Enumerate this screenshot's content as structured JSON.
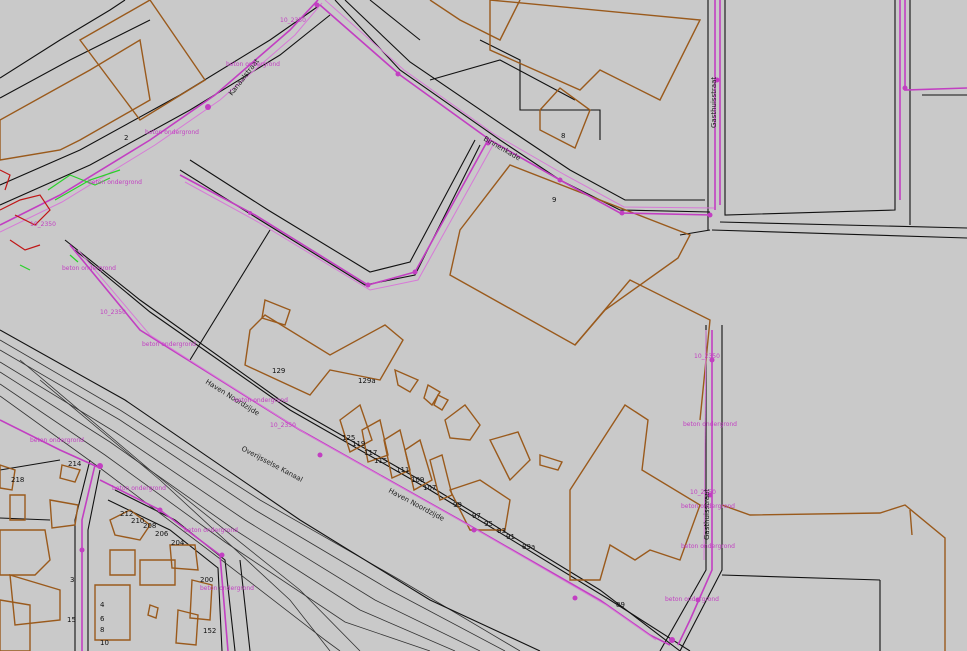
{
  "map": {
    "colors": {
      "background": "#c9c9c9",
      "parcel_lines": "#111111",
      "buildings": "#9a5a1c",
      "cables": "#c23fc2",
      "markings_green": "#2ad12a",
      "markings_red": "#c01616"
    },
    "streets": {
      "kanaalstraat": "Kanaalstraat",
      "overijsselse_kanaal": "Overijsselse Kanaal",
      "haven_noordzijde_1": "Haven Noordzijde",
      "haven_noordzijde_2": "Haven Noordzijde",
      "binnenkade": "Binnenkade",
      "gasthuisstraat_1": "Gasthuisstraat",
      "gasthuisstraat_2": "Gasthuisstraat"
    },
    "house_numbers": {
      "n2": "2",
      "n8": "8",
      "n9": "9",
      "n129": "129",
      "n129a": "129a",
      "n125": "125",
      "n119": "119",
      "n117": "117",
      "n115": "115",
      "n111": "111",
      "n109": "109",
      "n107": "107",
      "n99": "99",
      "n97": "97",
      "n95": "95",
      "n93": "93",
      "n91": "91",
      "n89a": "89a",
      "n89": "89",
      "n214": "214",
      "n218": "218",
      "n212": "212",
      "n210": "210",
      "n208": "208",
      "n206": "206",
      "n204": "204",
      "n200": "200",
      "n152": "152",
      "n3": "3",
      "n4": "4",
      "n6": "6",
      "n8b": "8",
      "n10": "10",
      "n15": "15"
    },
    "cable_labels": {
      "c1": "beton ondergrond",
      "c2": "beton ondergrond",
      "c3": "beton ondergrond",
      "c4": "beton ondergrond",
      "c5": "beton ondergrond",
      "c6": "beton ondergrond",
      "c7": "beton ondergrond",
      "c8": "beton ondergrond",
      "c9": "beton ondergrond",
      "c10": "beton ondergrond",
      "c11": "beton ondergrond",
      "c12": "beton ondergrond",
      "c13": "beton ondergrond",
      "c14": "beton ondergrond"
    },
    "cable_codes": {
      "k1": "10_2350",
      "k2": "10_2350",
      "k3": "10_2350",
      "k4": "10_2350",
      "k5": "10_2350",
      "k6": "10_2350"
    }
  }
}
